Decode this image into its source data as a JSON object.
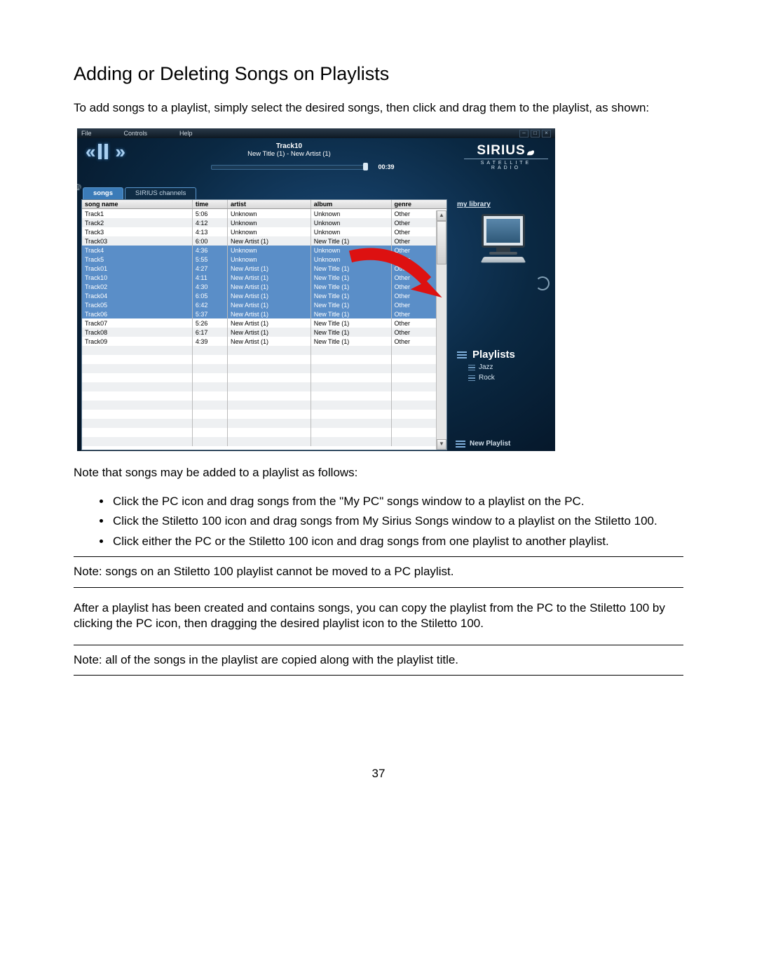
{
  "doc": {
    "title": "Adding or Deleting Songs on Playlists",
    "intro": "To add songs to a playlist, simply select the desired songs, then click and drag them to the playlist, as shown:",
    "note_lead": "Note that songs may be added to a playlist as follows:",
    "bullets": [
      "Click the PC icon and drag songs from the \"My PC\" songs window to a playlist on the PC.",
      "Click the Stiletto 100 icon and drag songs from My Sirius Songs window to a playlist on the Stiletto 100.",
      "Click either the PC or the Stiletto 100 icon and drag songs from one playlist to another playlist."
    ],
    "note1": "Note: songs on an Stiletto 100 playlist cannot be moved to a PC playlist.",
    "after": "After a playlist has been created and contains songs, you can copy the playlist from the PC to the Stiletto 100 by clicking the PC icon, then dragging the desired playlist icon to the Stiletto 100.",
    "note2": "Note: all of the songs in the playlist are copied along with the playlist title.",
    "page": "37"
  },
  "app": {
    "menu": {
      "file": "File",
      "controls": "Controls",
      "help": "Help"
    },
    "now_playing": {
      "track": "Track10",
      "subtitle": "New Title (1) - New Artist (1)",
      "elapsed": "00:39"
    },
    "brand": {
      "name": "SIRIUS",
      "tag": "SATELLITE RADIO"
    },
    "tabs": {
      "songs": "songs",
      "channels": "SIRIUS channels"
    },
    "columns": {
      "name": "song name",
      "time": "time",
      "artist": "artist",
      "album": "album",
      "genre": "genre"
    },
    "side": {
      "mylibrary": "my library",
      "playlists": "Playlists",
      "items": [
        "Jazz",
        "Rock"
      ],
      "new": "New Playlist"
    },
    "tracks": [
      {
        "sel": false,
        "name": "Track1",
        "time": "5:06",
        "artist": "Unknown",
        "album": "Unknown",
        "genre": "Other"
      },
      {
        "sel": false,
        "name": "Track2",
        "time": "4:12",
        "artist": "Unknown",
        "album": "Unknown",
        "genre": "Other"
      },
      {
        "sel": false,
        "name": "Track3",
        "time": "4:13",
        "artist": "Unknown",
        "album": "Unknown",
        "genre": "Other"
      },
      {
        "sel": false,
        "name": "Track03",
        "time": "6:00",
        "artist": "New Artist (1)",
        "album": "New Title (1)",
        "genre": "Other"
      },
      {
        "sel": true,
        "name": "Track4",
        "time": "4:36",
        "artist": "Unknown",
        "album": "Unknown",
        "genre": "Other"
      },
      {
        "sel": true,
        "name": "Track5",
        "time": "5:55",
        "artist": "Unknown",
        "album": "Unknown",
        "genre": "Other"
      },
      {
        "sel": true,
        "name": "Track01",
        "time": "4:27",
        "artist": "New Artist (1)",
        "album": "New Title (1)",
        "genre": "Other"
      },
      {
        "sel": true,
        "name": "Track10",
        "time": "4:11",
        "artist": "New Artist (1)",
        "album": "New Title (1)",
        "genre": "Other"
      },
      {
        "sel": true,
        "name": "Track02",
        "time": "4:30",
        "artist": "New Artist (1)",
        "album": "New Title (1)",
        "genre": "Other"
      },
      {
        "sel": true,
        "name": "Track04",
        "time": "6:05",
        "artist": "New Artist (1)",
        "album": "New Title (1)",
        "genre": "Other"
      },
      {
        "sel": true,
        "name": "Track05",
        "time": "6:42",
        "artist": "New Artist (1)",
        "album": "New Title (1)",
        "genre": "Other"
      },
      {
        "sel": true,
        "name": "Track06",
        "time": "5:37",
        "artist": "New Artist (1)",
        "album": "New Title (1)",
        "genre": "Other"
      },
      {
        "sel": false,
        "name": "Track07",
        "time": "5:26",
        "artist": "New Artist (1)",
        "album": "New Title (1)",
        "genre": "Other"
      },
      {
        "sel": false,
        "name": "Track08",
        "time": "6:17",
        "artist": "New Artist (1)",
        "album": "New Title (1)",
        "genre": "Other"
      },
      {
        "sel": false,
        "name": "Track09",
        "time": "4:39",
        "artist": "New Artist (1)",
        "album": "New Title (1)",
        "genre": "Other"
      }
    ]
  }
}
